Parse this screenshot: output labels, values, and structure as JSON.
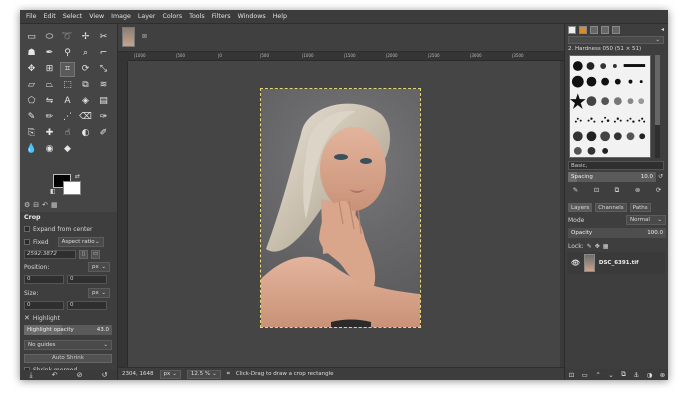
{
  "menubar": [
    "File",
    "Edit",
    "Select",
    "View",
    "Image",
    "Layer",
    "Colors",
    "Tools",
    "Filters",
    "Windows",
    "Help"
  ],
  "toolbox": {
    "tools": [
      {
        "icon": "rect-select-icon",
        "glyph": "▭"
      },
      {
        "icon": "ellipse-select-icon",
        "glyph": "⬭"
      },
      {
        "icon": "lasso-icon",
        "glyph": "➰"
      },
      {
        "icon": "fuzzy-select-icon",
        "glyph": "✢"
      },
      {
        "icon": "scissors-select-icon",
        "glyph": "✂"
      },
      {
        "icon": "foreground-select-icon",
        "glyph": "☗"
      },
      {
        "icon": "paths-icon",
        "glyph": "✒"
      },
      {
        "icon": "color-picker-icon",
        "glyph": "⚲"
      },
      {
        "icon": "zoom-icon",
        "glyph": "⌕"
      },
      {
        "icon": "measure-icon",
        "glyph": "⌐"
      },
      {
        "icon": "move-icon",
        "glyph": "✥"
      },
      {
        "icon": "align-icon",
        "glyph": "⊞"
      },
      {
        "icon": "crop-icon",
        "glyph": "⌗"
      },
      {
        "icon": "rotate-icon",
        "glyph": "⟳"
      },
      {
        "icon": "scale-icon",
        "glyph": "⤡"
      },
      {
        "icon": "shear-icon",
        "glyph": "▱"
      },
      {
        "icon": "perspective-icon",
        "glyph": "⏢"
      },
      {
        "icon": "3d-transform-icon",
        "glyph": "⬚"
      },
      {
        "icon": "unified-transform-icon",
        "glyph": "⧉"
      },
      {
        "icon": "warp-icon",
        "glyph": "≋"
      },
      {
        "icon": "cage-icon",
        "glyph": "⬠"
      },
      {
        "icon": "flip-icon",
        "glyph": "⇋"
      },
      {
        "icon": "text-icon",
        "glyph": "A"
      },
      {
        "icon": "bucket-fill-icon",
        "glyph": "◈"
      },
      {
        "icon": "gradient-icon",
        "glyph": "▤"
      },
      {
        "icon": "paintbrush-icon",
        "glyph": "✎"
      },
      {
        "icon": "pencil-icon",
        "glyph": "✏"
      },
      {
        "icon": "airbrush-icon",
        "glyph": "⋰"
      },
      {
        "icon": "eraser-icon",
        "glyph": "⌫"
      },
      {
        "icon": "ink-icon",
        "glyph": "✑"
      },
      {
        "icon": "clone-icon",
        "glyph": "⎘"
      },
      {
        "icon": "heal-icon",
        "glyph": "✚"
      },
      {
        "icon": "smudge-icon",
        "glyph": "☝"
      },
      {
        "icon": "dodge-burn-icon",
        "glyph": "◐"
      },
      {
        "icon": "mypaint-brush-icon",
        "glyph": "✐"
      },
      {
        "icon": "blur-icon",
        "glyph": "💧"
      },
      {
        "icon": "convolve-icon",
        "glyph": "◉"
      },
      {
        "icon": "sharpen-icon",
        "glyph": "◆"
      }
    ],
    "active_index": 12
  },
  "tool_options": {
    "title": "Crop",
    "expand_from_center": "Expand from center",
    "fixed_label": "Fixed",
    "aspect_ratio": "Aspect ratio",
    "ratio_value": "2592:3872",
    "position_label": "Position:",
    "position_unit": "px",
    "position_x": "0",
    "position_y": "0",
    "size_label": "Size:",
    "size_unit": "px",
    "size_w": "0",
    "size_h": "0",
    "highlight_label": "Highlight",
    "highlight_opacity_label": "Highlight opacity",
    "highlight_opacity_value": "43.0",
    "highlight_opacity_level": 0.43,
    "guides": "No guides",
    "auto_shrink": "Auto Shrink",
    "shrink_merged": "Shrink merged"
  },
  "rulers": {
    "h_ticks": [
      "|1000",
      "|500",
      "|0",
      "|500",
      "|1000",
      "|1500",
      "|2000",
      "|2500",
      "|3000",
      "|3500"
    ]
  },
  "statusbar": {
    "coords": "2304, 1648",
    "unit": "px",
    "zoom": "12.5 %",
    "message": "Click-Drag to draw a crop rectangle"
  },
  "brushes": {
    "name": "2. Hardness 050 (51 × 51)",
    "tag": "Basic,",
    "spacing_label": "Spacing",
    "spacing_value": "10.0",
    "spacing_level": 0.1
  },
  "layers": {
    "tabs": [
      "Layers",
      "Channels",
      "Paths"
    ],
    "mode_label": "Mode",
    "mode_value": "Normal",
    "opacity_label": "Opacity",
    "opacity_value": "100.0",
    "opacity_level": 1.0,
    "lock_label": "Lock:",
    "layer_name": "DSC_6391.tif"
  },
  "colors": {
    "foreground": "#000000",
    "background": "#ffffff",
    "selection_outline": "#e8d77a"
  }
}
